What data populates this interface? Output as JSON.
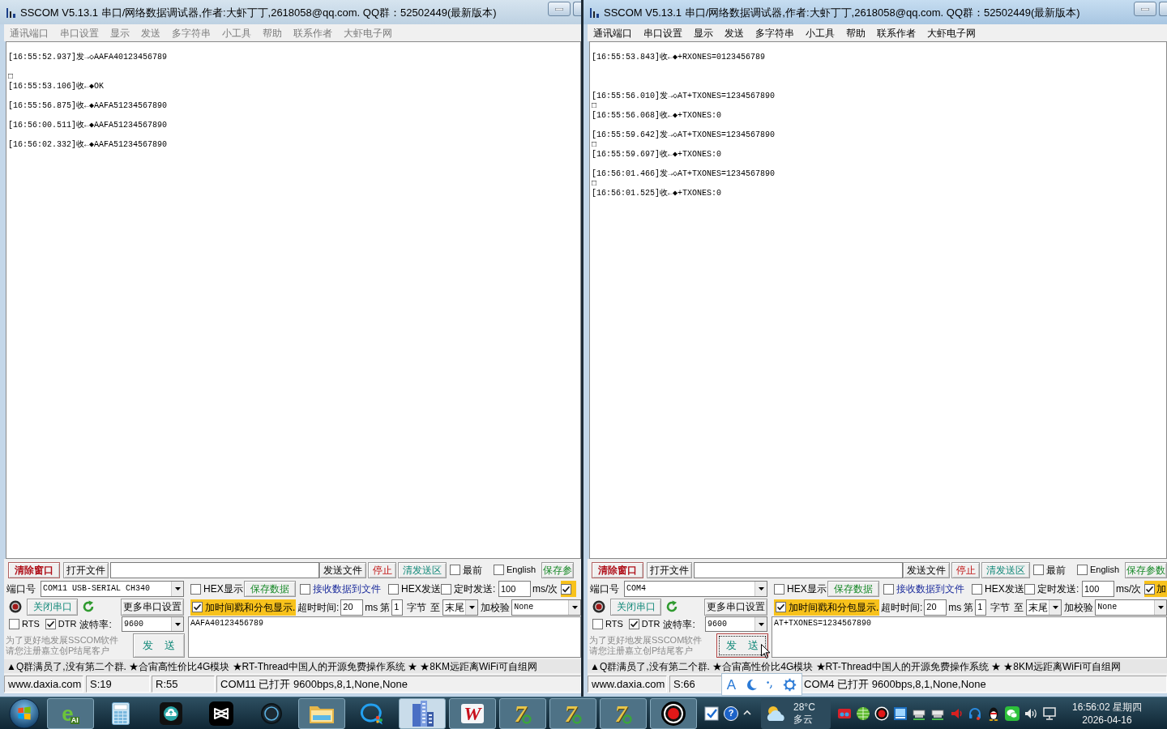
{
  "windows": [
    {
      "active": false,
      "title": "SSCOM V5.13.1 串口/网络数据调试器,作者:大虾丁丁,2618058@qq.com. QQ群：52502449(最新版本)",
      "menu": [
        "通讯端口",
        "串口设置",
        "显示",
        "发送",
        "多字符串",
        "小工具",
        "帮助",
        "联系作者",
        "大虾电子网"
      ],
      "log": [
        {
          "kind": "line",
          "text": "[16:55:52.937]发→◇AAFA40123456789"
        },
        {
          "kind": "blank"
        },
        {
          "kind": "line",
          "text": "□"
        },
        {
          "kind": "line",
          "text": "[16:55:53.106]收←◆OK"
        },
        {
          "kind": "blank"
        },
        {
          "kind": "line",
          "text": "[16:55:56.875]收←◆AAFA51234567890"
        },
        {
          "kind": "blank"
        },
        {
          "kind": "line",
          "text": "[16:56:00.511]收←◆AAFA51234567890"
        },
        {
          "kind": "blank"
        },
        {
          "kind": "line",
          "text": "[16:56:02.332]收←◆AAFA51234567890"
        }
      ],
      "toolbar": {
        "clear_button": "清除窗口",
        "open_file_button": "打开文件",
        "send_file_button": "发送文件",
        "stop_button": "停止",
        "clear_send_button": "清发送区",
        "options": [
          {
            "label": "最前",
            "checked": false
          },
          {
            "label": "English",
            "checked": false
          }
        ],
        "save_params_button": "保存参"
      },
      "port": {
        "label": "端口号",
        "value": "COM11 USB-SERIAL CH340",
        "close_button": "关闭串口",
        "more_button": "更多串口设置",
        "lines": [
          {
            "label": "RTS",
            "checked": false
          },
          {
            "label": "DTR",
            "checked": true
          }
        ],
        "baud_label": "波特率:",
        "baud": "9600",
        "notice": [
          "为了更好地发展SSCOM软件",
          "请您注册嘉立创P结尾客户"
        ],
        "send_button": "发 送",
        "send_focused": false
      },
      "receive": {
        "hex_display": {
          "label": "HEX显示",
          "checked": false
        },
        "save_data_button": "保存数据",
        "to_file": {
          "label": "接收数据到文件",
          "checked": false
        },
        "timestamp": {
          "label": "加时间戳和分包显示.",
          "checked": true
        },
        "timeout_label": "超时时间:",
        "timeout": "20",
        "timeout_unit": "ms"
      },
      "send": {
        "hex_send": {
          "label": "HEX发送",
          "checked": false
        },
        "timed_send": {
          "label": "定时发送:",
          "checked": false
        },
        "interval": "100",
        "interval_unit": "ms/次",
        "extra": {
          "checked": true
        },
        "from_label": "第",
        "from": "1",
        "bytes_label": "字节",
        "to_label": "至",
        "to": "末尾",
        "checksum_label": "加校验",
        "checksum": "None",
        "text": "AAFA40123456789"
      },
      "ticker": "▲Q群满员了,没有第二个群. ★合宙高性价比4G模块 ★RT-Thread中国人的开源免费操作系统 ★ ★8KM远距离WiFi可自组网",
      "status_bar": {
        "site": "www.daxia.com",
        "sent": "S:19",
        "received": "R:55",
        "port_status": "COM11 已打开 9600bps,8,1,None,None"
      }
    },
    {
      "active": true,
      "title": "SSCOM V5.13.1 串口/网络数据调试器,作者:大虾丁丁,2618058@qq.com. QQ群：52502449(最新版本)",
      "menu": [
        "通讯端口",
        "串口设置",
        "显示",
        "发送",
        "多字符串",
        "小工具",
        "帮助",
        "联系作者",
        "大虾电子网"
      ],
      "log": [
        {
          "kind": "line",
          "text": "[16:55:53.843]收←◆+RXONES=0123456789"
        },
        {
          "kind": "blank"
        },
        {
          "kind": "blank"
        },
        {
          "kind": "blank"
        },
        {
          "kind": "line",
          "text": "[16:55:56.010]发→◇AT+TXONES=1234567890"
        },
        {
          "kind": "line",
          "text": "□"
        },
        {
          "kind": "line",
          "text": "[16:55:56.068]收←◆+TXONES:0"
        },
        {
          "kind": "blank"
        },
        {
          "kind": "line",
          "text": "[16:55:59.642]发→◇AT+TXONES=1234567890"
        },
        {
          "kind": "line",
          "text": "□"
        },
        {
          "kind": "line",
          "text": "[16:55:59.697]收←◆+TXONES:0"
        },
        {
          "kind": "blank"
        },
        {
          "kind": "line",
          "text": "[16:56:01.466]发→◇AT+TXONES=1234567890"
        },
        {
          "kind": "line",
          "text": "□"
        },
        {
          "kind": "line",
          "text": "[16:56:01.525]收←◆+TXONES:0"
        }
      ],
      "toolbar": {
        "clear_button": "清除窗口",
        "open_file_button": "打开文件",
        "send_file_button": "发送文件",
        "stop_button": "停止",
        "clear_send_button": "清发送区",
        "options": [
          {
            "label": "最前",
            "checked": false
          },
          {
            "label": "English",
            "checked": false
          }
        ],
        "save_params_button": "保存参数"
      },
      "port": {
        "label": "端口号",
        "value": "COM4",
        "close_button": "关闭串口",
        "more_button": "更多串口设置",
        "lines": [
          {
            "label": "RTS",
            "checked": false
          },
          {
            "label": "DTR",
            "checked": true
          }
        ],
        "baud_label": "波特率:",
        "baud": "9600",
        "notice": [
          "为了更好地发展SSCOM软件",
          "请您注册嘉立创P结尾客户"
        ],
        "send_button": "发 送",
        "send_focused": true
      },
      "receive": {
        "hex_display": {
          "label": "HEX显示",
          "checked": false
        },
        "save_data_button": "保存数据",
        "to_file": {
          "label": "接收数据到文件",
          "checked": false
        },
        "timestamp": {
          "label": "加时间戳和分包显示.",
          "checked": true
        },
        "timeout_label": "超时时间:",
        "timeout": "20",
        "timeout_unit": "ms"
      },
      "send": {
        "hex_send": {
          "label": "HEX发送",
          "checked": false
        },
        "timed_send": {
          "label": "定时发送:",
          "checked": false
        },
        "interval": "100",
        "interval_unit": "ms/次",
        "extra": {
          "checked": true,
          "label": "加"
        },
        "from_label": "第",
        "from": "1",
        "bytes_label": "字节",
        "to_label": "至",
        "to": "末尾",
        "checksum_label": "加校验",
        "checksum": "None",
        "text": "AT+TXONES=1234567890"
      },
      "ticker": "▲Q群满员了,没有第二个群. ★合宙高性价比4G模块 ★RT-Thread中国人的开源免费操作系统 ★ ★8KM远距离WiFi可自组网",
      "status_bar": {
        "site": "www.daxia.com",
        "sent": "S:66",
        "port_status": "COM4 已打开 9600bps,8,1,None,None"
      }
    }
  ],
  "ime_toolbar": {
    "mode": "A"
  },
  "taskbar": {
    "apps": [
      {
        "kind": "browser",
        "glyph": "e",
        "badge": "AI",
        "running": true,
        "selected": false
      },
      {
        "kind": "calculator",
        "running": false,
        "selected": false
      },
      {
        "kind": "cloud-app",
        "running": false,
        "selected": false
      },
      {
        "kind": "video-editor",
        "running": false,
        "selected": false
      },
      {
        "kind": "ring",
        "running": false,
        "selected": false
      },
      {
        "kind": "folder",
        "running": true,
        "selected": false
      },
      {
        "kind": "chat",
        "running": false,
        "selected": false
      },
      {
        "kind": "buildings",
        "running": true,
        "selected": true
      },
      {
        "kind": "office",
        "glyph": "W",
        "running": true,
        "selected": false
      },
      {
        "kind": "seven",
        "glyph": "7",
        "running": true,
        "selected": false
      },
      {
        "kind": "seven",
        "glyph": "7",
        "running": true,
        "selected": false
      },
      {
        "kind": "seven",
        "glyph": "7",
        "running": true,
        "selected": false
      },
      {
        "kind": "recorder",
        "running": true,
        "selected": false
      }
    ],
    "notify": [
      {
        "kind": "check"
      },
      {
        "kind": "help",
        "glyph": "?"
      },
      {
        "kind": "expand"
      }
    ],
    "weather": {
      "temperature": "28°C",
      "condition": "多云"
    },
    "tray": [
      {
        "kind": "red-app"
      },
      {
        "kind": "globe"
      },
      {
        "kind": "record"
      },
      {
        "kind": "screen"
      },
      {
        "kind": "drive"
      },
      {
        "kind": "drive"
      },
      {
        "kind": "alert-speaker"
      },
      {
        "kind": "headset"
      },
      {
        "kind": "penguin"
      },
      {
        "kind": "chat"
      },
      {
        "kind": "volume"
      },
      {
        "kind": "monitor"
      }
    ],
    "clock": {
      "time": "16:56:02 星期四",
      "date": "2026-04-16"
    }
  }
}
